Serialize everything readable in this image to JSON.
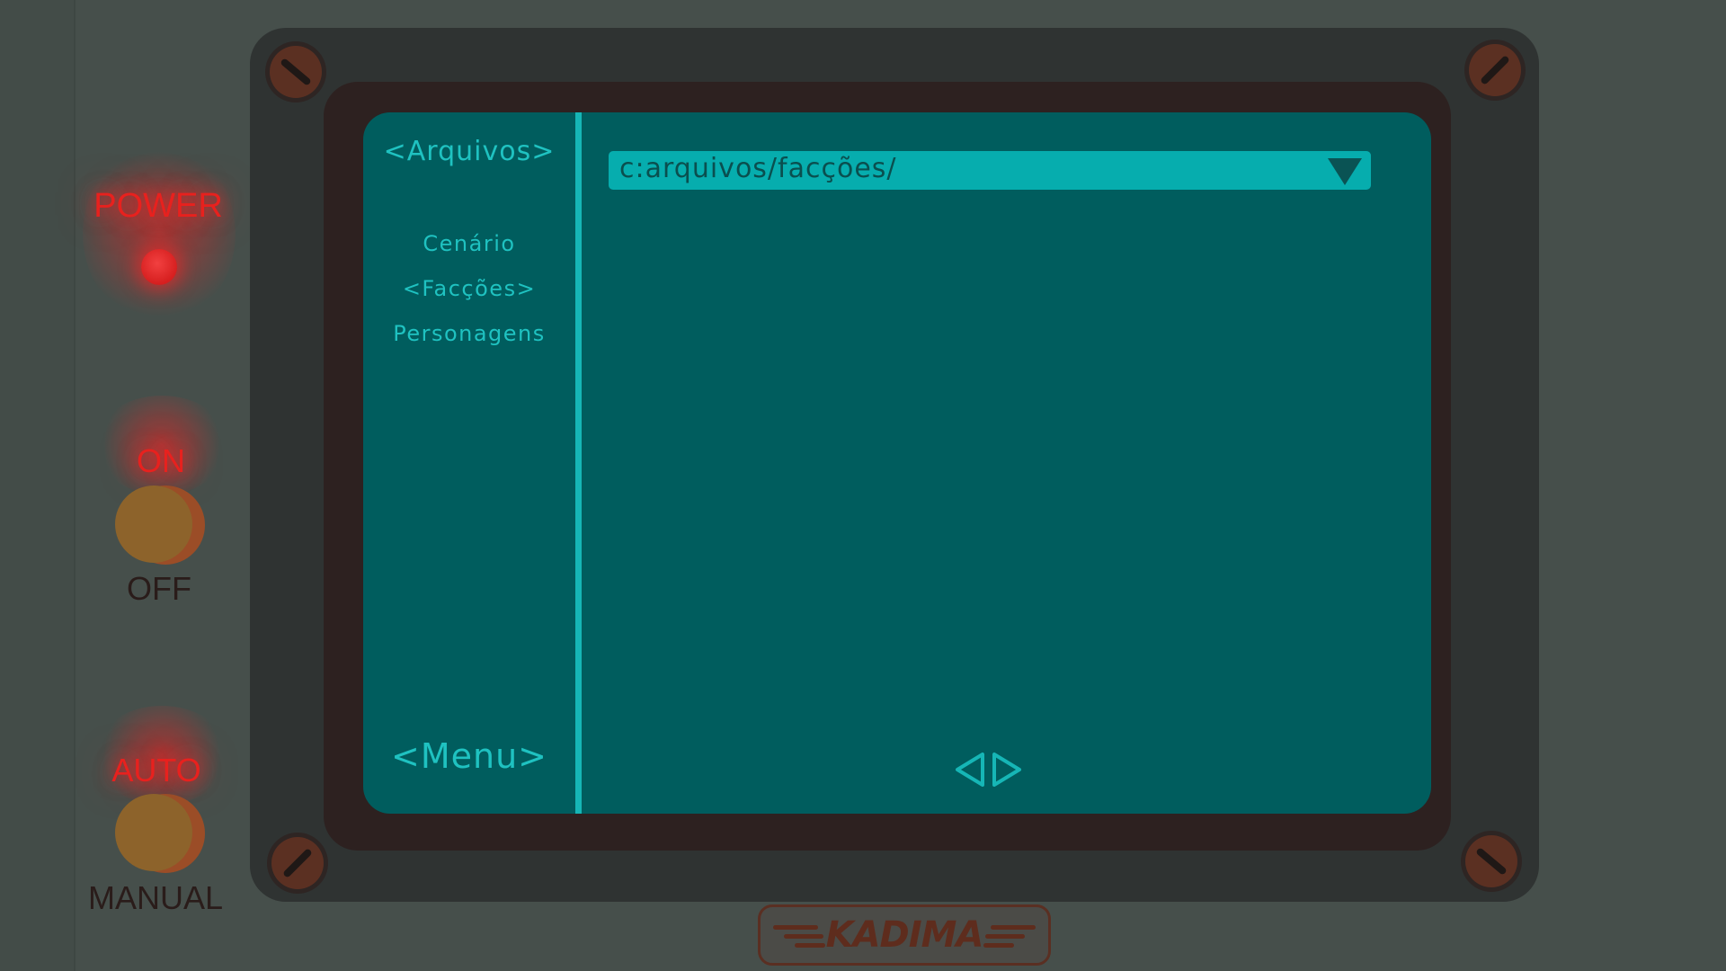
{
  "controls": {
    "power_label": "POWER",
    "on_label": "ON",
    "off_label": "OFF",
    "auto_label": "AUTO",
    "manual_label": "MANUAL"
  },
  "sidebar": {
    "title": "<Arquivos>",
    "items": [
      {
        "label": "Cenário"
      },
      {
        "label": "<Facções>"
      },
      {
        "label": "Personagens"
      }
    ],
    "menu_label": "<Menu>"
  },
  "main": {
    "path": "c:arquivos/facções/",
    "dropdown_icon": "triangle-down-icon",
    "nav": {
      "prev_icon": "triangle-left-icon",
      "next_icon": "triangle-right-icon"
    }
  },
  "brand": {
    "logo_text": "KADIMA"
  },
  "colors": {
    "screen_bg": "#005d5e",
    "screen_text": "#1fc2c1",
    "accent": "#06adae",
    "indicator_red": "#e8211e"
  }
}
